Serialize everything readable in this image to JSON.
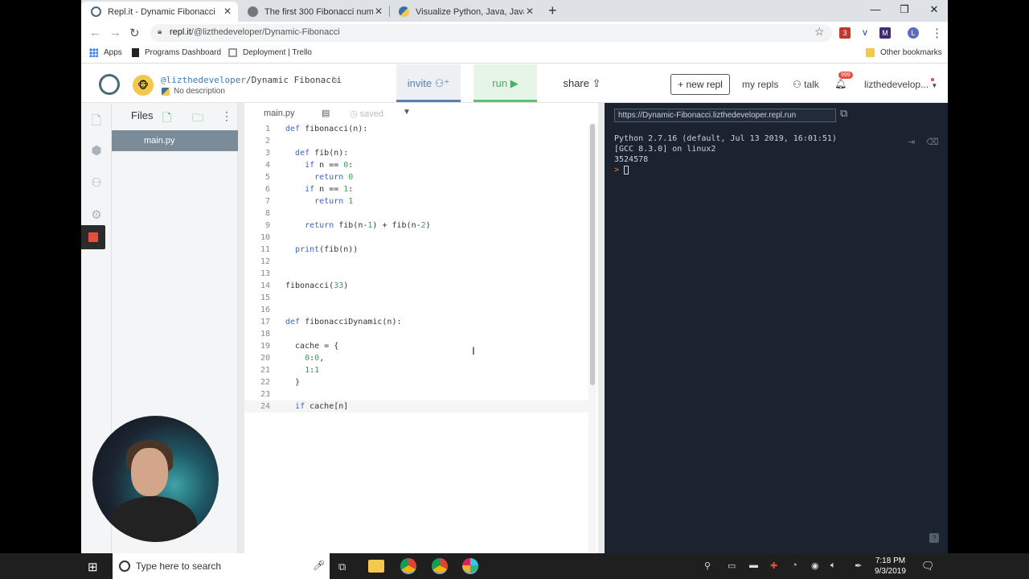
{
  "browser": {
    "tabs": [
      {
        "title": "Repl.it - Dynamic Fibonacci",
        "active": true
      },
      {
        "title": "The first 300 Fibonacci numbers",
        "active": false
      },
      {
        "title": "Visualize Python, Java, JavaScript",
        "active": false
      }
    ],
    "url_host": "repl.it",
    "url_path": "/@lizthedeveloper/Dynamic-Fibonacci",
    "ext_badge": "3",
    "profile_initial": "L",
    "bookmarks": {
      "apps": "Apps",
      "item1": "Programs Dashboard",
      "item2": "Deployment | Trello",
      "other": "Other bookmarks"
    }
  },
  "repl": {
    "user": "@lizthedeveloper",
    "project": "Dynamic Fibonacci",
    "description": "No description",
    "invite": "invite",
    "run": "run",
    "share": "share",
    "new_repl": "+ new repl",
    "my_repls": "my repls",
    "talk": "talk",
    "notifications": "999",
    "username": "lizthedevelop..."
  },
  "files": {
    "title": "Files",
    "items": [
      "main.py"
    ]
  },
  "editor": {
    "tab": "main.py",
    "status": "saved",
    "lines": [
      "def fibonacci(n):",
      "",
      "  def fib(n):",
      "    if n == 0:",
      "      return 0",
      "    if n == 1:",
      "      return 1",
      "",
      "    return fib(n-1) + fib(n-2)",
      "",
      "  print(fib(n))",
      "",
      "",
      "fibonacci(33)",
      "",
      "",
      "def fibonacciDynamic(n):",
      "",
      "  cache = {",
      "    0:0,",
      "    1:1",
      "  }",
      "",
      "  if cache[n]"
    ]
  },
  "console": {
    "url": "https://Dynamic-Fibonacci.lizthedeveloper.repl.run",
    "output": "Python 2.7.16 (default, Jul 13 2019, 16:01:51)\n[GCC 8.3.0] on linux2\n3524578",
    "prompt": ">"
  },
  "taskbar": {
    "search": "Type here to search",
    "time": "7:18 PM",
    "date": "9/3/2019"
  },
  "colors": {
    "run": "#5fc06f",
    "invite": "#5a7fb0",
    "console_bg": "#1b2331",
    "stop": "#e74c3c"
  }
}
